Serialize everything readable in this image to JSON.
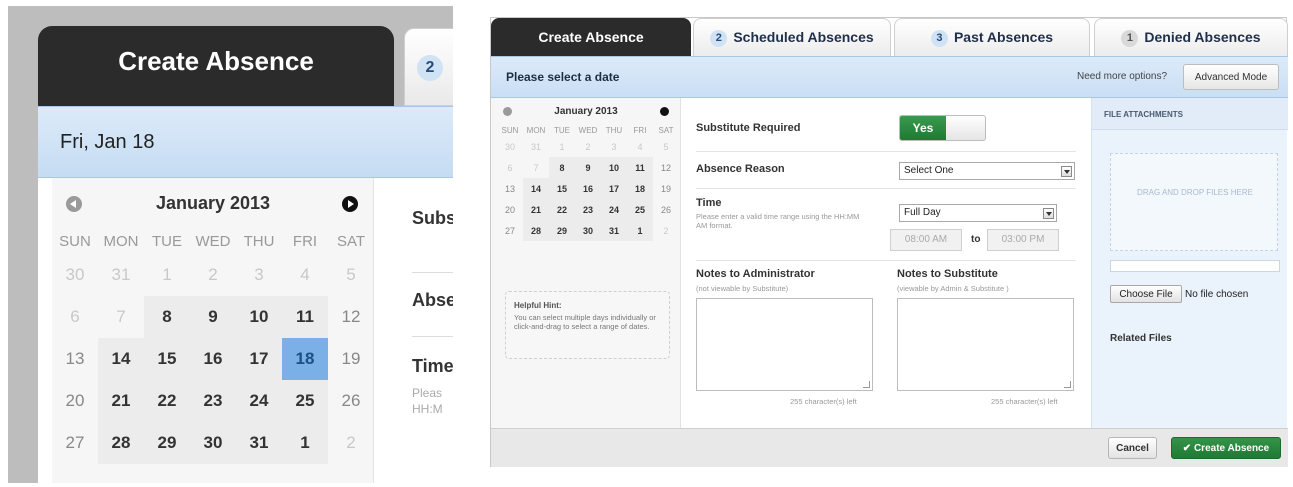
{
  "tabs": [
    {
      "label": "Create Absence",
      "badge": ""
    },
    {
      "label": "Scheduled Absences",
      "badge": "2"
    },
    {
      "label": "Past Absences",
      "badge": "3"
    },
    {
      "label": "Denied Absences",
      "badge": "1"
    }
  ],
  "zoom": {
    "selected_date": "Fri, Jan 18",
    "right_labels": [
      "Subs",
      "Abse",
      "Time"
    ],
    "right_hints": [
      "Pleas",
      "HH:M"
    ]
  },
  "datebar": {
    "prompt": "Please select a date",
    "more_options": "Need more options?",
    "advanced_button": "Advanced Mode"
  },
  "calendar": {
    "month": "January 2013",
    "weekdays": [
      "SUN",
      "MON",
      "TUE",
      "WED",
      "THU",
      "FRI",
      "SAT"
    ],
    "weeks": [
      [
        "30",
        "31",
        "1",
        "2",
        "3",
        "4",
        "5"
      ],
      [
        "6",
        "7",
        "8",
        "9",
        "10",
        "11",
        "12"
      ],
      [
        "13",
        "14",
        "15",
        "16",
        "17",
        "18",
        "19"
      ],
      [
        "20",
        "21",
        "22",
        "23",
        "24",
        "25",
        "26"
      ],
      [
        "27",
        "28",
        "29",
        "30",
        "31",
        "1",
        "2"
      ]
    ],
    "selected_day": "18"
  },
  "hint": {
    "title": "Helpful Hint:",
    "body": "You can select multiple days individually or click-and-drag to select a range of dates."
  },
  "form": {
    "substitute_label": "Substitute Required",
    "toggle_value": "Yes",
    "reason_label": "Absence Reason",
    "reason_value": "Select One",
    "time_label": "Time",
    "time_help": "Please enter a valid time range using the HH:MM AM format.",
    "time_value": "Full Day",
    "start_time": "08:00 AM",
    "to_label": "to",
    "end_time": "03:00 PM",
    "notes_admin_label": "Notes to Administrator",
    "notes_admin_sub": "(not viewable by Substitute)",
    "notes_sub_label": "Notes to Substitute",
    "notes_sub_sub": "(viewable by Admin & Substitute )",
    "chars_left": "255 character(s) left"
  },
  "attachments": {
    "title": "FILE ATTACHMENTS",
    "drop_text": "DRAG AND DROP FILES HERE",
    "choose_button": "Choose File",
    "no_file": "No file chosen",
    "related": "Related Files"
  },
  "footer": {
    "cancel": "Cancel",
    "create": "✔ Create Absence"
  },
  "colors": {
    "tab_active": "#2b2b2b",
    "date_bar": "#c9dff4",
    "toggle_on": "#1f7a33",
    "create_button": "#1f7a33",
    "selected_day": "#7ab0e6"
  }
}
